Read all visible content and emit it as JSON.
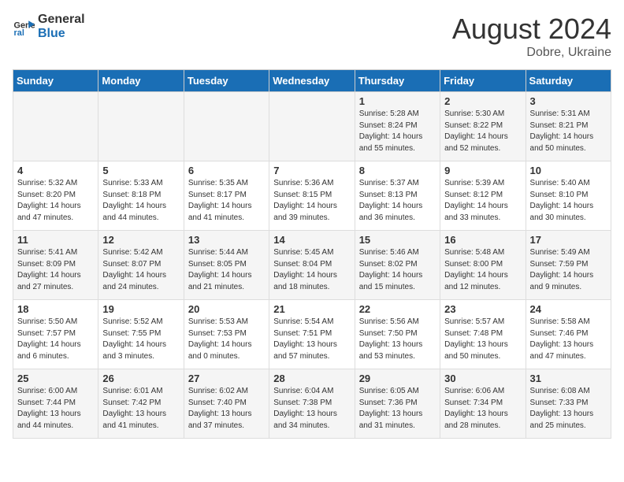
{
  "header": {
    "logo_line1": "General",
    "logo_line2": "Blue",
    "month_year": "August 2024",
    "location": "Dobre, Ukraine"
  },
  "weekdays": [
    "Sunday",
    "Monday",
    "Tuesday",
    "Wednesday",
    "Thursday",
    "Friday",
    "Saturday"
  ],
  "weeks": [
    [
      {
        "day": "",
        "info": ""
      },
      {
        "day": "",
        "info": ""
      },
      {
        "day": "",
        "info": ""
      },
      {
        "day": "",
        "info": ""
      },
      {
        "day": "1",
        "info": "Sunrise: 5:28 AM\nSunset: 8:24 PM\nDaylight: 14 hours\nand 55 minutes."
      },
      {
        "day": "2",
        "info": "Sunrise: 5:30 AM\nSunset: 8:22 PM\nDaylight: 14 hours\nand 52 minutes."
      },
      {
        "day": "3",
        "info": "Sunrise: 5:31 AM\nSunset: 8:21 PM\nDaylight: 14 hours\nand 50 minutes."
      }
    ],
    [
      {
        "day": "4",
        "info": "Sunrise: 5:32 AM\nSunset: 8:20 PM\nDaylight: 14 hours\nand 47 minutes."
      },
      {
        "day": "5",
        "info": "Sunrise: 5:33 AM\nSunset: 8:18 PM\nDaylight: 14 hours\nand 44 minutes."
      },
      {
        "day": "6",
        "info": "Sunrise: 5:35 AM\nSunset: 8:17 PM\nDaylight: 14 hours\nand 41 minutes."
      },
      {
        "day": "7",
        "info": "Sunrise: 5:36 AM\nSunset: 8:15 PM\nDaylight: 14 hours\nand 39 minutes."
      },
      {
        "day": "8",
        "info": "Sunrise: 5:37 AM\nSunset: 8:13 PM\nDaylight: 14 hours\nand 36 minutes."
      },
      {
        "day": "9",
        "info": "Sunrise: 5:39 AM\nSunset: 8:12 PM\nDaylight: 14 hours\nand 33 minutes."
      },
      {
        "day": "10",
        "info": "Sunrise: 5:40 AM\nSunset: 8:10 PM\nDaylight: 14 hours\nand 30 minutes."
      }
    ],
    [
      {
        "day": "11",
        "info": "Sunrise: 5:41 AM\nSunset: 8:09 PM\nDaylight: 14 hours\nand 27 minutes."
      },
      {
        "day": "12",
        "info": "Sunrise: 5:42 AM\nSunset: 8:07 PM\nDaylight: 14 hours\nand 24 minutes."
      },
      {
        "day": "13",
        "info": "Sunrise: 5:44 AM\nSunset: 8:05 PM\nDaylight: 14 hours\nand 21 minutes."
      },
      {
        "day": "14",
        "info": "Sunrise: 5:45 AM\nSunset: 8:04 PM\nDaylight: 14 hours\nand 18 minutes."
      },
      {
        "day": "15",
        "info": "Sunrise: 5:46 AM\nSunset: 8:02 PM\nDaylight: 14 hours\nand 15 minutes."
      },
      {
        "day": "16",
        "info": "Sunrise: 5:48 AM\nSunset: 8:00 PM\nDaylight: 14 hours\nand 12 minutes."
      },
      {
        "day": "17",
        "info": "Sunrise: 5:49 AM\nSunset: 7:59 PM\nDaylight: 14 hours\nand 9 minutes."
      }
    ],
    [
      {
        "day": "18",
        "info": "Sunrise: 5:50 AM\nSunset: 7:57 PM\nDaylight: 14 hours\nand 6 minutes."
      },
      {
        "day": "19",
        "info": "Sunrise: 5:52 AM\nSunset: 7:55 PM\nDaylight: 14 hours\nand 3 minutes."
      },
      {
        "day": "20",
        "info": "Sunrise: 5:53 AM\nSunset: 7:53 PM\nDaylight: 14 hours\nand 0 minutes."
      },
      {
        "day": "21",
        "info": "Sunrise: 5:54 AM\nSunset: 7:51 PM\nDaylight: 13 hours\nand 57 minutes."
      },
      {
        "day": "22",
        "info": "Sunrise: 5:56 AM\nSunset: 7:50 PM\nDaylight: 13 hours\nand 53 minutes."
      },
      {
        "day": "23",
        "info": "Sunrise: 5:57 AM\nSunset: 7:48 PM\nDaylight: 13 hours\nand 50 minutes."
      },
      {
        "day": "24",
        "info": "Sunrise: 5:58 AM\nSunset: 7:46 PM\nDaylight: 13 hours\nand 47 minutes."
      }
    ],
    [
      {
        "day": "25",
        "info": "Sunrise: 6:00 AM\nSunset: 7:44 PM\nDaylight: 13 hours\nand 44 minutes."
      },
      {
        "day": "26",
        "info": "Sunrise: 6:01 AM\nSunset: 7:42 PM\nDaylight: 13 hours\nand 41 minutes."
      },
      {
        "day": "27",
        "info": "Sunrise: 6:02 AM\nSunset: 7:40 PM\nDaylight: 13 hours\nand 37 minutes."
      },
      {
        "day": "28",
        "info": "Sunrise: 6:04 AM\nSunset: 7:38 PM\nDaylight: 13 hours\nand 34 minutes."
      },
      {
        "day": "29",
        "info": "Sunrise: 6:05 AM\nSunset: 7:36 PM\nDaylight: 13 hours\nand 31 minutes."
      },
      {
        "day": "30",
        "info": "Sunrise: 6:06 AM\nSunset: 7:34 PM\nDaylight: 13 hours\nand 28 minutes."
      },
      {
        "day": "31",
        "info": "Sunrise: 6:08 AM\nSunset: 7:33 PM\nDaylight: 13 hours\nand 25 minutes."
      }
    ]
  ]
}
